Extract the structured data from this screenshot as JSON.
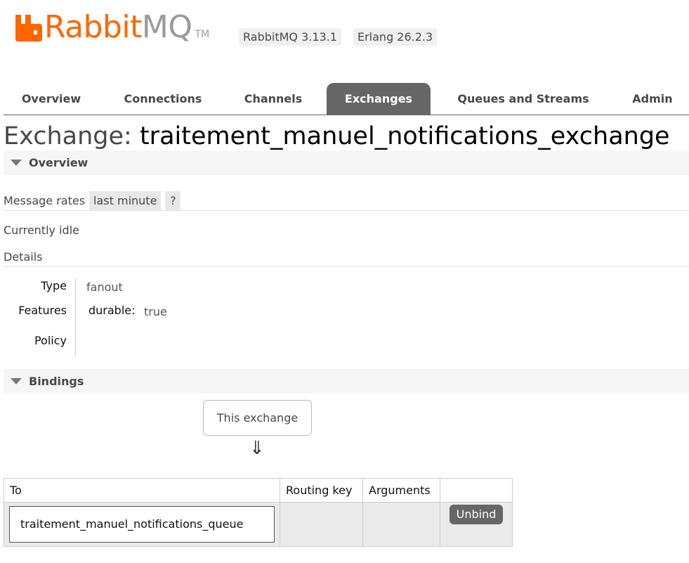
{
  "header": {
    "logo_rabbit": "Rabbit",
    "logo_mq": "MQ",
    "logo_tm": "TM",
    "versions": [
      "RabbitMQ 3.13.1",
      "Erlang 26.2.3"
    ]
  },
  "tabs": [
    {
      "label": "Overview",
      "active": false
    },
    {
      "label": "Connections",
      "active": false
    },
    {
      "label": "Channels",
      "active": false
    },
    {
      "label": "Exchanges",
      "active": true
    },
    {
      "label": "Queues and Streams",
      "active": false
    },
    {
      "label": "Admin",
      "active": false
    }
  ],
  "title": {
    "prefix": "Exchange:",
    "name": "traitement_manuel_notifications_exchange"
  },
  "overview": {
    "header": "Overview",
    "message_rates_label": "Message rates",
    "rate_period": "last minute",
    "help": "?",
    "status": "Currently idle",
    "details_label": "Details",
    "facts": {
      "type_label": "Type",
      "type_value": "fanout",
      "features_label": "Features",
      "durable_label": "durable:",
      "durable_value": "true",
      "policy_label": "Policy"
    }
  },
  "bindings": {
    "header": "Bindings",
    "source": "This exchange",
    "arrow": "⇓",
    "columns": [
      "To",
      "Routing key",
      "Arguments"
    ],
    "rows": [
      {
        "to": "traitement_manuel_notifications_queue",
        "routing_key": "",
        "arguments": "",
        "action": "Unbind"
      }
    ]
  },
  "colors": {
    "brand_orange": "#ff6600",
    "tab_active": "#666666",
    "button": "#666666"
  }
}
